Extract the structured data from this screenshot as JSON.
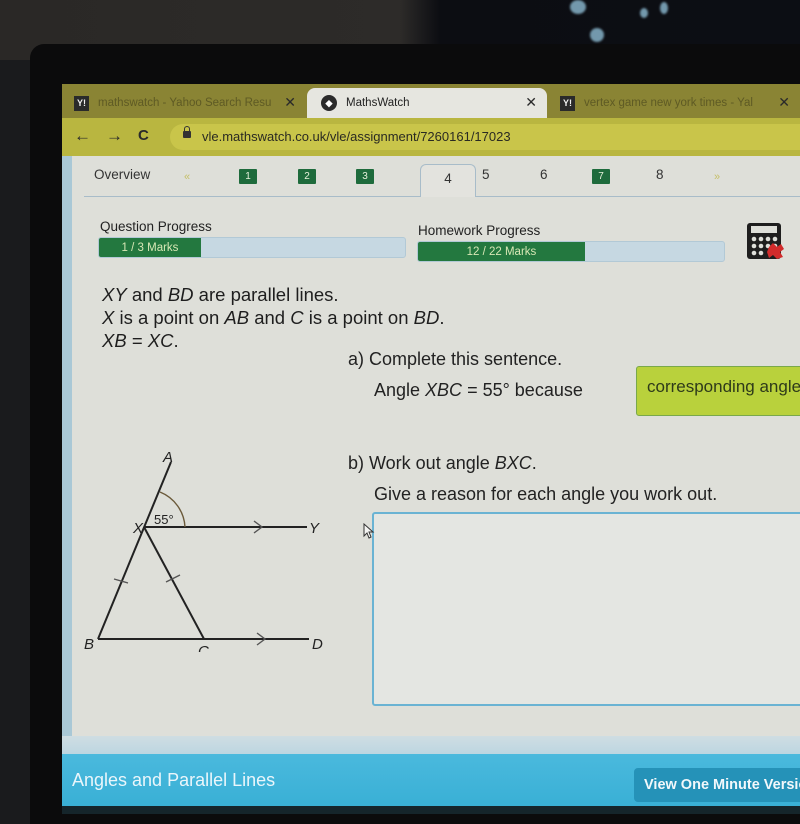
{
  "browser": {
    "tabs": [
      {
        "favicon": "Y!",
        "title": "mathswatch - Yahoo Search Resu",
        "active": false
      },
      {
        "favicon": "mathswatch-logo",
        "title": "MathsWatch",
        "active": true
      },
      {
        "favicon": "Y!",
        "title": "vertex game new york times - Yal",
        "active": false
      }
    ],
    "nav": {
      "back": "←",
      "forward": "→",
      "reload": "C"
    },
    "url": "vle.mathswatch.co.uk/vle/assignment/7260161/17023"
  },
  "question_nav": {
    "overview": "Overview",
    "prev": "«",
    "next": "»",
    "items": [
      {
        "label": "1",
        "state": "done"
      },
      {
        "label": "2",
        "state": "done"
      },
      {
        "label": "3",
        "state": "done"
      },
      {
        "label": "4",
        "state": "current"
      },
      {
        "label": "5",
        "state": "todo"
      },
      {
        "label": "6",
        "state": "todo"
      },
      {
        "label": "7",
        "state": "done"
      },
      {
        "label": "8",
        "state": "todo"
      }
    ]
  },
  "progress": {
    "question": {
      "label": "Question Progress",
      "text": "1 / 3 Marks",
      "value": 1,
      "max": 3
    },
    "homework": {
      "label": "Homework Progress",
      "text": "12 / 22 Marks",
      "value": 12,
      "max": 22
    }
  },
  "question": {
    "lines": [
      [
        "XY",
        " and ",
        "BD",
        " are parallel lines."
      ],
      [
        "X",
        " is a point on ",
        "AB",
        " and ",
        "C",
        " is a point on ",
        "BD",
        "."
      ],
      [
        "XB",
        " = ",
        "XC",
        "."
      ]
    ],
    "diagram": {
      "labels": {
        "A": "A",
        "X": "X",
        "Y": "Y",
        "B": "B",
        "C": "C",
        "D": "D"
      },
      "angle": "55°"
    },
    "part_a": {
      "heading": "a) Complete this sentence.",
      "sentence_pre": "Angle ",
      "sentence_var": "XBC",
      "sentence_post": " = 55° because",
      "answer": "corresponding angles"
    },
    "part_b": {
      "heading_pre": "b) Work out angle ",
      "heading_var": "BXC",
      "heading_post": ".",
      "instruction": "Give a reason for each angle you work out.",
      "answer": ""
    }
  },
  "footer": {
    "title": "Angles and Parallel Lines",
    "button": "View One Minute Version"
  },
  "colors": {
    "accent_green": "#23783f",
    "answer_green": "#b9d13c",
    "footer_blue": "#3fb4d9",
    "input_border": "#6ab3d3"
  }
}
